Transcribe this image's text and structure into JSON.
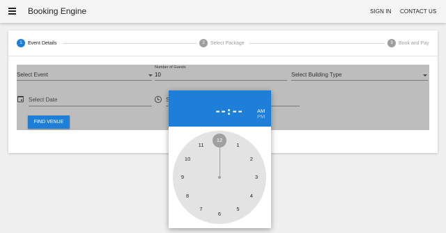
{
  "appbar": {
    "title": "Booking Engine",
    "sign_in": "SIGN IN",
    "contact_us": "CONTACT US",
    "menu_icon": "menu-icon"
  },
  "stepper": {
    "steps": [
      {
        "number": "1",
        "label": "Event Details",
        "state": "active"
      },
      {
        "number": "2",
        "label": "Select Package",
        "state": "inactive"
      },
      {
        "number": "3",
        "label": "Book and Pay",
        "state": "inactive"
      }
    ]
  },
  "form": {
    "select_event": "Select Event",
    "guests_label": "Number of Guests",
    "guests_value": "10",
    "building_type": "Select Building Type",
    "date_placeholder": "Select Date",
    "time_placeholder_partial": "S",
    "find_venue": "FIND VENUE"
  },
  "time_picker": {
    "display": "--:--",
    "am": "AM",
    "pm": "PM",
    "selected_hour": "12",
    "hours": [
      "12",
      "1",
      "2",
      "3",
      "4",
      "5",
      "6",
      "7",
      "8",
      "9",
      "10",
      "11"
    ]
  },
  "colors": {
    "primary": "#1e7fd8",
    "form_bg": "#bdbdbd",
    "inactive": "#9e9e9e"
  }
}
